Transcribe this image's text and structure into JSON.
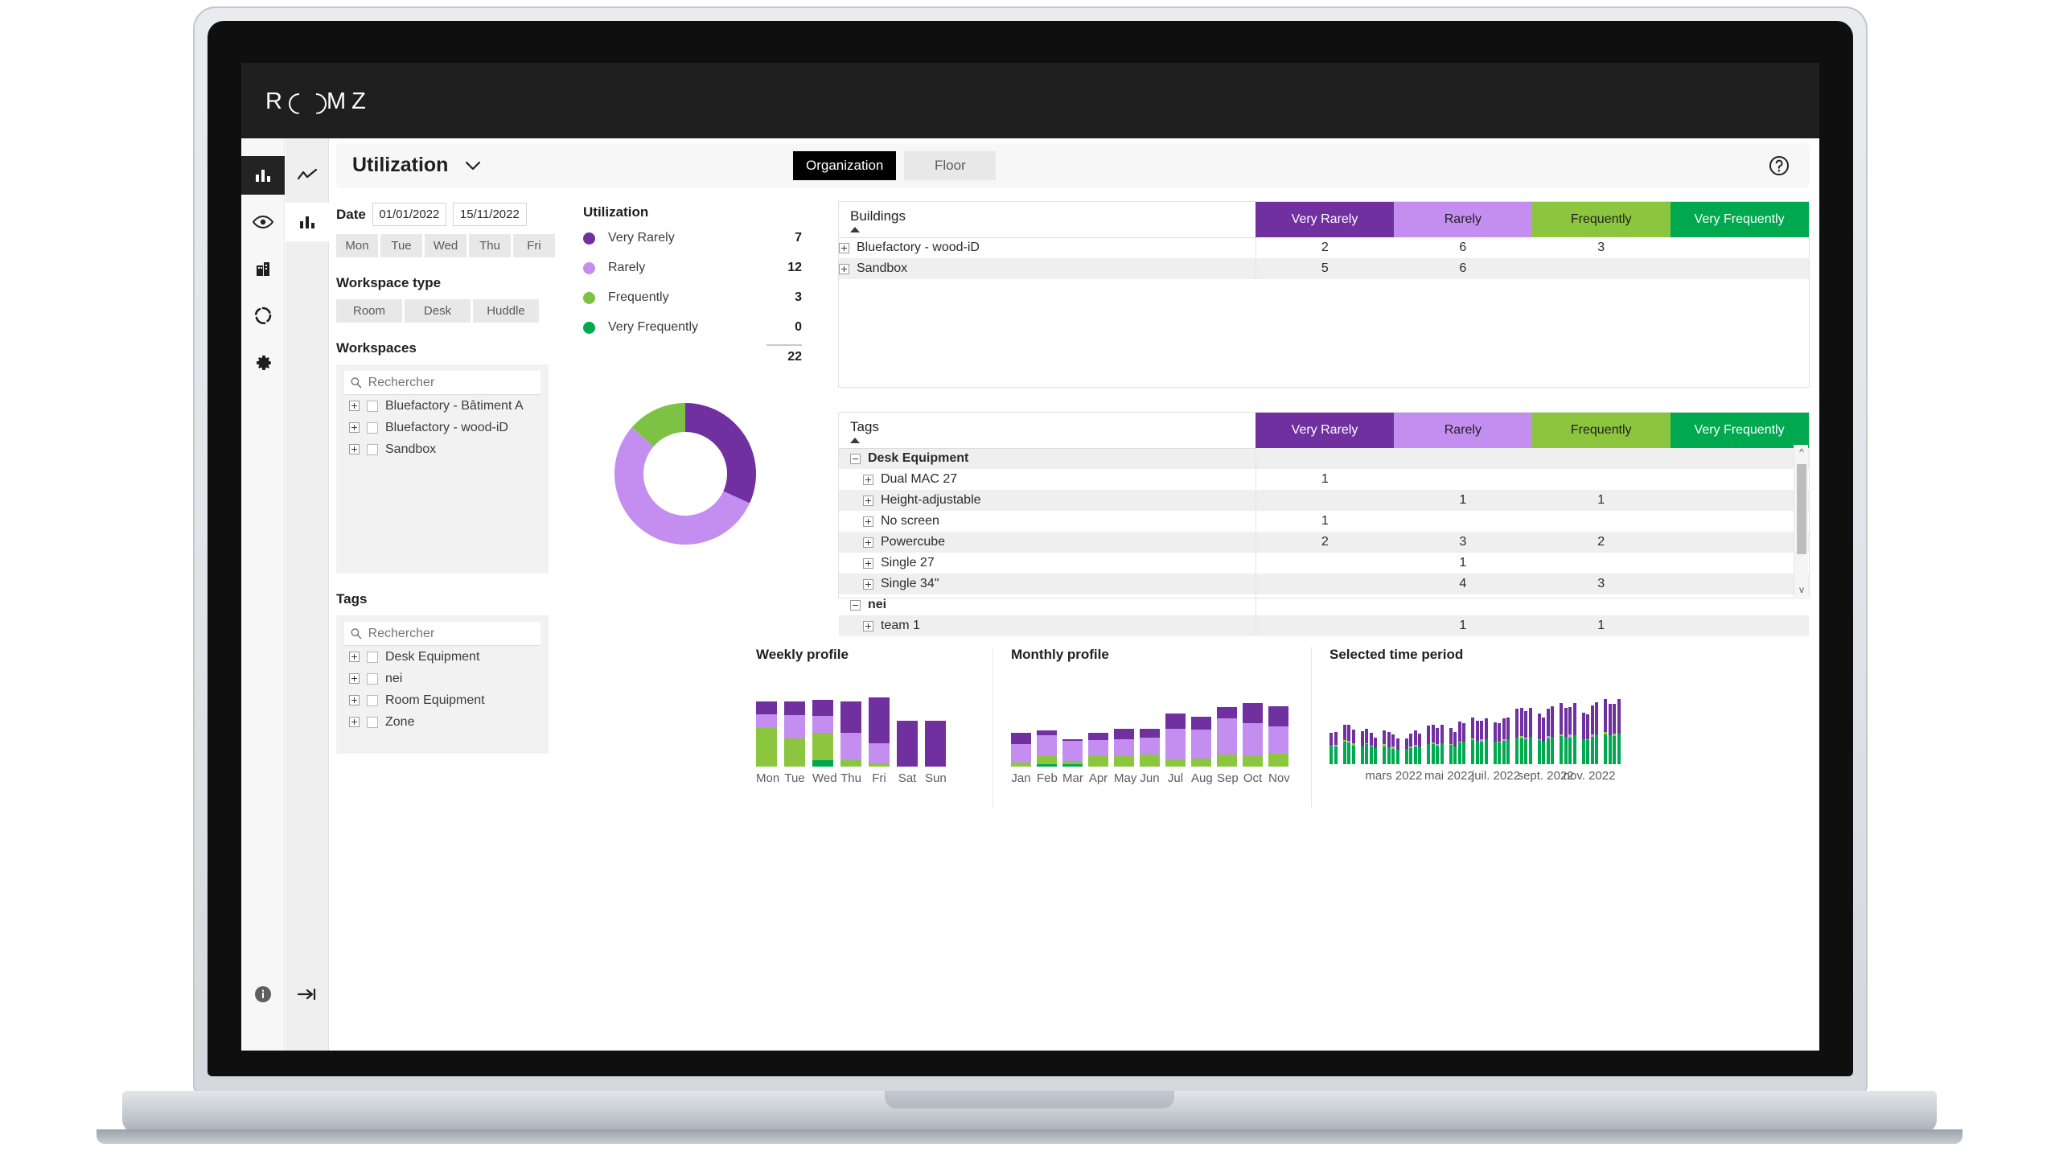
{
  "brand": {
    "text_left": "R",
    "text_right": "M",
    "text_last": "Z"
  },
  "header": {
    "title": "Utilization",
    "tabs": [
      {
        "label": "Organization",
        "active": true
      },
      {
        "label": "Floor",
        "active": false
      }
    ],
    "help_icon": "help-circle-icon"
  },
  "sidebar": {
    "primary": [
      {
        "name": "bar-chart-icon",
        "active": true
      },
      {
        "name": "eye-icon",
        "active": false
      },
      {
        "name": "building-icon",
        "active": false
      },
      {
        "name": "donut-icon",
        "active": false
      },
      {
        "name": "gear-icon",
        "active": false
      }
    ],
    "secondary": [
      {
        "name": "trend-line-icon",
        "active": false
      },
      {
        "name": "bar-chart-icon",
        "active": true
      }
    ],
    "footer": [
      {
        "name": "info-icon"
      },
      {
        "name": "collapse-arrow-icon"
      }
    ]
  },
  "filters": {
    "date_label": "Date",
    "date_from": "01/01/2022",
    "date_to": "15/11/2022",
    "days": [
      "Mon",
      "Tue",
      "Wed",
      "Thu",
      "Fri"
    ],
    "days_next_icon": "chevron-right-icon",
    "workspace_type_label": "Workspace type",
    "workspace_types": [
      "Room",
      "Desk",
      "Huddle"
    ],
    "workspaces_label": "Workspaces",
    "workspaces_search_placeholder": "Rechercher",
    "workspaces_search_value": "",
    "workspaces": [
      "Bluefactory - Bâtiment A",
      "Bluefactory - wood-iD",
      "Sandbox"
    ],
    "tags_label": "Tags",
    "tags_search_placeholder": "Rechercher",
    "tags_search_value": "",
    "tags": [
      "Desk Equipment",
      "nei",
      "Room Equipment",
      "Zone"
    ]
  },
  "utilization": {
    "title": "Utilization",
    "legend": [
      {
        "label": "Very Rarely",
        "value": "7",
        "color": "#7030a0"
      },
      {
        "label": "Rarely",
        "value": "12",
        "color": "#c38ef0"
      },
      {
        "label": "Frequently",
        "value": "3",
        "color": "#7dc242"
      },
      {
        "label": "Very Frequently",
        "value": "0",
        "color": "#00a94f"
      }
    ],
    "total": "22"
  },
  "buildings_table": {
    "name_header": "Buildings",
    "sort_icon": "sort-ascending-caret",
    "columns": [
      {
        "label": "Very Rarely",
        "bg": "#7030a0",
        "fg": "#ffffff"
      },
      {
        "label": "Rarely",
        "bg": "#c38ef0",
        "fg": "#1f1f1f"
      },
      {
        "label": "Frequently",
        "bg": "#8cc63e",
        "fg": "#1f1f1f"
      },
      {
        "label": "Very Frequently",
        "bg": "#00a94f",
        "fg": "#ffffff"
      }
    ],
    "rows": [
      {
        "name": "Bluefactory - wood-iD",
        "indent": 0,
        "group": false,
        "expander": "plus",
        "values": [
          "2",
          "6",
          "3",
          ""
        ]
      },
      {
        "name": "Sandbox",
        "indent": 0,
        "group": false,
        "expander": "plus",
        "values": [
          "5",
          "6",
          "",
          ""
        ]
      }
    ]
  },
  "tags_table": {
    "name_header": "Tags",
    "sort_icon": "sort-ascending-caret",
    "columns": [
      {
        "label": "Very Rarely",
        "bg": "#7030a0",
        "fg": "#ffffff"
      },
      {
        "label": "Rarely",
        "bg": "#c38ef0",
        "fg": "#1f1f1f"
      },
      {
        "label": "Frequently",
        "bg": "#8cc63e",
        "fg": "#1f1f1f"
      },
      {
        "label": "Very Frequently",
        "bg": "#00a94f",
        "fg": "#ffffff"
      }
    ],
    "rows": [
      {
        "name": "Desk Equipment",
        "indent": 0,
        "group": true,
        "expander": "minus",
        "values": [
          "",
          "",
          "",
          ""
        ]
      },
      {
        "name": "Dual MAC 27",
        "indent": 1,
        "group": false,
        "expander": "plus",
        "values": [
          "1",
          "",
          "",
          ""
        ]
      },
      {
        "name": "Height-adjustable",
        "indent": 1,
        "group": false,
        "expander": "plus",
        "values": [
          "",
          "1",
          "1",
          ""
        ]
      },
      {
        "name": "No screen",
        "indent": 1,
        "group": false,
        "expander": "plus",
        "values": [
          "1",
          "",
          "",
          ""
        ]
      },
      {
        "name": "Powercube",
        "indent": 1,
        "group": false,
        "expander": "plus",
        "values": [
          "2",
          "3",
          "2",
          ""
        ]
      },
      {
        "name": "Single 27",
        "indent": 1,
        "group": false,
        "expander": "plus",
        "values": [
          "",
          "1",
          "",
          ""
        ]
      },
      {
        "name": "Single 34\"",
        "indent": 1,
        "group": false,
        "expander": "plus",
        "values": [
          "",
          "4",
          "3",
          ""
        ]
      },
      {
        "name": "nei",
        "indent": 0,
        "group": true,
        "expander": "minus",
        "values": [
          "",
          "",
          "",
          ""
        ]
      },
      {
        "name": "team 1",
        "indent": 1,
        "group": false,
        "expander": "plus",
        "values": [
          "",
          "1",
          "1",
          ""
        ]
      }
    ],
    "scrollbar": {
      "up_icon": "chevron-up-icon",
      "down_icon": "chevron-down-icon"
    }
  },
  "chart_data": [
    {
      "id": "weekly",
      "type": "bar",
      "title": "Weekly profile",
      "stacked": true,
      "categories": [
        "Mon",
        "Tue",
        "Wed",
        "Thu",
        "Fri"
      ],
      "tick_labels": [
        "Mon",
        "Tue",
        "Wed",
        "Thu",
        "Fri",
        "Sat",
        "Sun"
      ],
      "x": [
        "Mon",
        "Tue",
        "Wed",
        "Thu",
        "Fri",
        "Sat",
        "Sun"
      ],
      "series": [
        {
          "name": "Very Frequently",
          "color": "#00a94f",
          "values": [
            0,
            0,
            8,
            0,
            0,
            0,
            0
          ]
        },
        {
          "name": "Frequently",
          "color": "#8cc63e",
          "values": [
            48,
            35,
            34,
            8,
            4,
            0,
            0
          ]
        },
        {
          "name": "Rarely",
          "color": "#c38ef0",
          "values": [
            17,
            29,
            21,
            34,
            25,
            0,
            0
          ]
        },
        {
          "name": "Very Rarely",
          "color": "#7030a0",
          "values": [
            16,
            17,
            20,
            39,
            57,
            57,
            57
          ]
        }
      ],
      "ylabel": "",
      "xlabel": "",
      "grid": false,
      "legend": "none"
    },
    {
      "id": "monthly",
      "type": "bar",
      "title": "Monthly profile",
      "stacked": true,
      "categories": [
        "Jan",
        "Feb",
        "Mar",
        "Apr",
        "May",
        "Jun",
        "Jul",
        "Aug",
        "Sep",
        "Oct",
        "Nov"
      ],
      "series": [
        {
          "name": "Very Frequently",
          "color": "#00a94f",
          "values": [
            0,
            3,
            3,
            0,
            0,
            0,
            0,
            0,
            0,
            0,
            0
          ]
        },
        {
          "name": "Frequently",
          "color": "#8cc63e",
          "values": [
            5,
            11,
            4,
            14,
            14,
            16,
            9,
            10,
            16,
            14,
            17
          ]
        },
        {
          "name": "Rarely",
          "color": "#c38ef0",
          "values": [
            24,
            27,
            26,
            21,
            22,
            22,
            40,
            38,
            47,
            43,
            35
          ]
        },
        {
          "name": "Very Rarely",
          "color": "#7030a0",
          "values": [
            15,
            6,
            3,
            9,
            13,
            11,
            20,
            17,
            14,
            26,
            26
          ]
        }
      ],
      "ylabel": "",
      "xlabel": "",
      "grid": false,
      "legend": "none"
    },
    {
      "id": "selected_time_period",
      "type": "bar",
      "title": "Selected time period",
      "stacked": true,
      "tick_labels": [
        "mars 2022",
        "mai 2022",
        "juil. 2022",
        "sept. 2022",
        "nov. 2022"
      ],
      "tick_positions_pct": [
        22,
        41,
        57,
        74,
        89
      ],
      "note": "Daily stacked bars across the selected date range; green = Very Frequently/Frequently at base, purple = Very Rarely on top.",
      "series": [
        {
          "name": "Very Frequently",
          "color": "#00a94f"
        },
        {
          "name": "Frequently",
          "color": "#8cc63e"
        },
        {
          "name": "Rarely",
          "color": "#c38ef0"
        },
        {
          "name": "Very Rarely",
          "color": "#7030a0"
        }
      ],
      "bars": [
        [
          32,
          0,
          0,
          20
        ],
        [
          30,
          0,
          2,
          22
        ],
        [
          0,
          0,
          0,
          0
        ],
        [
          38,
          2,
          0,
          26
        ],
        [
          36,
          0,
          3,
          27
        ],
        [
          31,
          4,
          0,
          22
        ],
        [
          0,
          0,
          0,
          0
        ],
        [
          30,
          0,
          0,
          25
        ],
        [
          33,
          2,
          0,
          24
        ],
        [
          29,
          0,
          2,
          21
        ],
        [
          27,
          0,
          0,
          17
        ],
        [
          0,
          0,
          0,
          0
        ],
        [
          30,
          3,
          0,
          23
        ],
        [
          28,
          0,
          0,
          25
        ],
        [
          26,
          2,
          2,
          20
        ],
        [
          24,
          0,
          0,
          19
        ],
        [
          0,
          0,
          0,
          0
        ],
        [
          25,
          0,
          0,
          18
        ],
        [
          27,
          2,
          0,
          22
        ],
        [
          29,
          0,
          3,
          24
        ],
        [
          30,
          0,
          0,
          21
        ],
        [
          0,
          0,
          0,
          0
        ],
        [
          34,
          0,
          0,
          30
        ],
        [
          33,
          3,
          0,
          29
        ],
        [
          31,
          0,
          2,
          27
        ],
        [
          35,
          0,
          0,
          31
        ],
        [
          0,
          0,
          0,
          0
        ],
        [
          32,
          2,
          0,
          26
        ],
        [
          30,
          0,
          0,
          24
        ],
        [
          36,
          0,
          2,
          33
        ],
        [
          38,
          0,
          0,
          30
        ],
        [
          0,
          0,
          0,
          0
        ],
        [
          40,
          3,
          0,
          34
        ],
        [
          39,
          0,
          0,
          33
        ],
        [
          37,
          2,
          2,
          31
        ],
        [
          41,
          0,
          0,
          35
        ],
        [
          0,
          0,
          0,
          0
        ],
        [
          38,
          0,
          0,
          32
        ],
        [
          36,
          2,
          0,
          30
        ],
        [
          39,
          0,
          3,
          34
        ],
        [
          42,
          0,
          0,
          36
        ],
        [
          0,
          0,
          0,
          0
        ],
        [
          44,
          0,
          0,
          48
        ],
        [
          43,
          4,
          0,
          46
        ],
        [
          41,
          0,
          3,
          44
        ],
        [
          45,
          0,
          0,
          49
        ],
        [
          0,
          0,
          0,
          0
        ],
        [
          40,
          2,
          0,
          42
        ],
        [
          38,
          0,
          0,
          40
        ],
        [
          43,
          0,
          4,
          45
        ],
        [
          46,
          0,
          0,
          50
        ],
        [
          0,
          0,
          0,
          0
        ],
        [
          47,
          3,
          0,
          52
        ],
        [
          45,
          0,
          0,
          48
        ],
        [
          44,
          2,
          3,
          46
        ],
        [
          48,
          0,
          0,
          53
        ],
        [
          0,
          0,
          0,
          0
        ],
        [
          42,
          0,
          0,
          44
        ],
        [
          40,
          2,
          0,
          41
        ],
        [
          46,
          0,
          3,
          49
        ],
        [
          49,
          0,
          0,
          54
        ],
        [
          0,
          0,
          0,
          0
        ],
        [
          50,
          3,
          0,
          56
        ],
        [
          48,
          0,
          0,
          52
        ],
        [
          47,
          2,
          2,
          50
        ],
        [
          51,
          0,
          0,
          57
        ]
      ],
      "ylabel": "",
      "xlabel": "",
      "grid": false,
      "legend": "none"
    }
  ]
}
